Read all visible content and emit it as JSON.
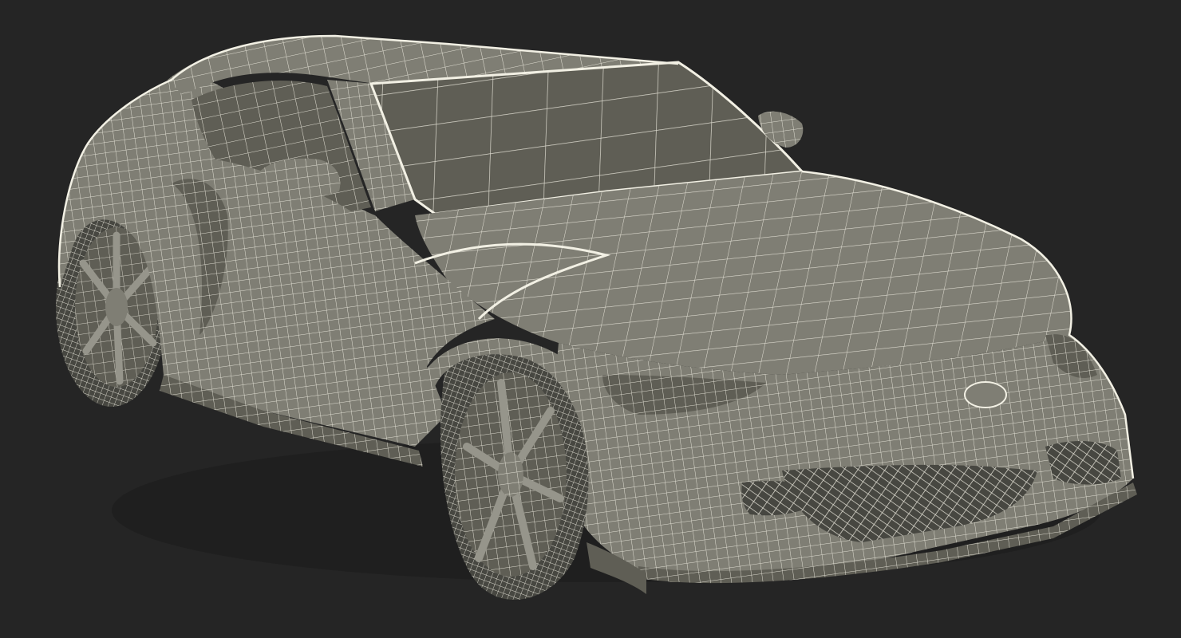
{
  "scene": {
    "background_color": "#252525",
    "surface_color": "#7f7e74",
    "surface_shadow_color": "#5f5e55",
    "surface_highlight_color": "#96958b",
    "wire_color": "#f2f0e4",
    "dark_color": "#474741",
    "subject": "sports-car-wireframe-model"
  }
}
